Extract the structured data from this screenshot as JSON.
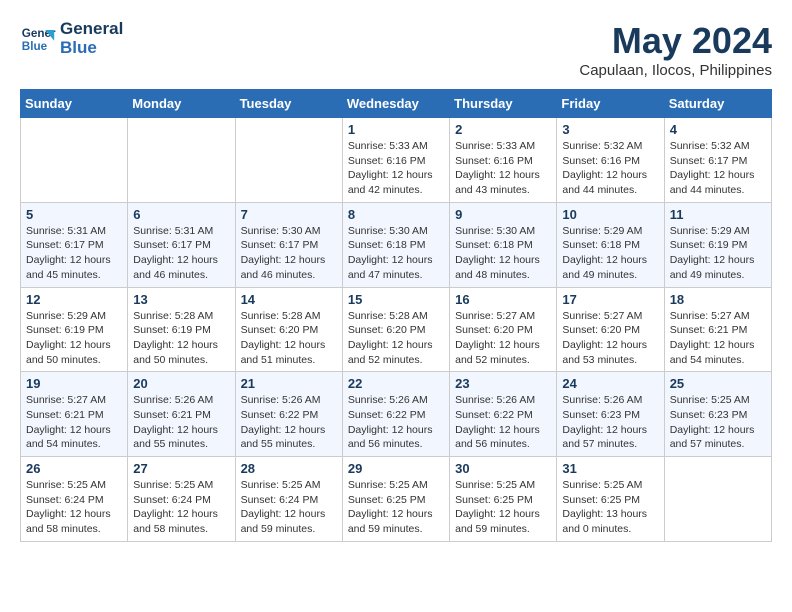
{
  "header": {
    "logo_line1": "General",
    "logo_line2": "Blue",
    "month_title": "May 2024",
    "location": "Capulaan, Ilocos, Philippines"
  },
  "weekdays": [
    "Sunday",
    "Monday",
    "Tuesday",
    "Wednesday",
    "Thursday",
    "Friday",
    "Saturday"
  ],
  "weeks": [
    [
      {
        "day": "",
        "info": ""
      },
      {
        "day": "",
        "info": ""
      },
      {
        "day": "",
        "info": ""
      },
      {
        "day": "1",
        "info": "Sunrise: 5:33 AM\nSunset: 6:16 PM\nDaylight: 12 hours\nand 42 minutes."
      },
      {
        "day": "2",
        "info": "Sunrise: 5:33 AM\nSunset: 6:16 PM\nDaylight: 12 hours\nand 43 minutes."
      },
      {
        "day": "3",
        "info": "Sunrise: 5:32 AM\nSunset: 6:16 PM\nDaylight: 12 hours\nand 44 minutes."
      },
      {
        "day": "4",
        "info": "Sunrise: 5:32 AM\nSunset: 6:17 PM\nDaylight: 12 hours\nand 44 minutes."
      }
    ],
    [
      {
        "day": "5",
        "info": "Sunrise: 5:31 AM\nSunset: 6:17 PM\nDaylight: 12 hours\nand 45 minutes."
      },
      {
        "day": "6",
        "info": "Sunrise: 5:31 AM\nSunset: 6:17 PM\nDaylight: 12 hours\nand 46 minutes."
      },
      {
        "day": "7",
        "info": "Sunrise: 5:30 AM\nSunset: 6:17 PM\nDaylight: 12 hours\nand 46 minutes."
      },
      {
        "day": "8",
        "info": "Sunrise: 5:30 AM\nSunset: 6:18 PM\nDaylight: 12 hours\nand 47 minutes."
      },
      {
        "day": "9",
        "info": "Sunrise: 5:30 AM\nSunset: 6:18 PM\nDaylight: 12 hours\nand 48 minutes."
      },
      {
        "day": "10",
        "info": "Sunrise: 5:29 AM\nSunset: 6:18 PM\nDaylight: 12 hours\nand 49 minutes."
      },
      {
        "day": "11",
        "info": "Sunrise: 5:29 AM\nSunset: 6:19 PM\nDaylight: 12 hours\nand 49 minutes."
      }
    ],
    [
      {
        "day": "12",
        "info": "Sunrise: 5:29 AM\nSunset: 6:19 PM\nDaylight: 12 hours\nand 50 minutes."
      },
      {
        "day": "13",
        "info": "Sunrise: 5:28 AM\nSunset: 6:19 PM\nDaylight: 12 hours\nand 50 minutes."
      },
      {
        "day": "14",
        "info": "Sunrise: 5:28 AM\nSunset: 6:20 PM\nDaylight: 12 hours\nand 51 minutes."
      },
      {
        "day": "15",
        "info": "Sunrise: 5:28 AM\nSunset: 6:20 PM\nDaylight: 12 hours\nand 52 minutes."
      },
      {
        "day": "16",
        "info": "Sunrise: 5:27 AM\nSunset: 6:20 PM\nDaylight: 12 hours\nand 52 minutes."
      },
      {
        "day": "17",
        "info": "Sunrise: 5:27 AM\nSunset: 6:20 PM\nDaylight: 12 hours\nand 53 minutes."
      },
      {
        "day": "18",
        "info": "Sunrise: 5:27 AM\nSunset: 6:21 PM\nDaylight: 12 hours\nand 54 minutes."
      }
    ],
    [
      {
        "day": "19",
        "info": "Sunrise: 5:27 AM\nSunset: 6:21 PM\nDaylight: 12 hours\nand 54 minutes."
      },
      {
        "day": "20",
        "info": "Sunrise: 5:26 AM\nSunset: 6:21 PM\nDaylight: 12 hours\nand 55 minutes."
      },
      {
        "day": "21",
        "info": "Sunrise: 5:26 AM\nSunset: 6:22 PM\nDaylight: 12 hours\nand 55 minutes."
      },
      {
        "day": "22",
        "info": "Sunrise: 5:26 AM\nSunset: 6:22 PM\nDaylight: 12 hours\nand 56 minutes."
      },
      {
        "day": "23",
        "info": "Sunrise: 5:26 AM\nSunset: 6:22 PM\nDaylight: 12 hours\nand 56 minutes."
      },
      {
        "day": "24",
        "info": "Sunrise: 5:26 AM\nSunset: 6:23 PM\nDaylight: 12 hours\nand 57 minutes."
      },
      {
        "day": "25",
        "info": "Sunrise: 5:25 AM\nSunset: 6:23 PM\nDaylight: 12 hours\nand 57 minutes."
      }
    ],
    [
      {
        "day": "26",
        "info": "Sunrise: 5:25 AM\nSunset: 6:24 PM\nDaylight: 12 hours\nand 58 minutes."
      },
      {
        "day": "27",
        "info": "Sunrise: 5:25 AM\nSunset: 6:24 PM\nDaylight: 12 hours\nand 58 minutes."
      },
      {
        "day": "28",
        "info": "Sunrise: 5:25 AM\nSunset: 6:24 PM\nDaylight: 12 hours\nand 59 minutes."
      },
      {
        "day": "29",
        "info": "Sunrise: 5:25 AM\nSunset: 6:25 PM\nDaylight: 12 hours\nand 59 minutes."
      },
      {
        "day": "30",
        "info": "Sunrise: 5:25 AM\nSunset: 6:25 PM\nDaylight: 12 hours\nand 59 minutes."
      },
      {
        "day": "31",
        "info": "Sunrise: 5:25 AM\nSunset: 6:25 PM\nDaylight: 13 hours\nand 0 minutes."
      },
      {
        "day": "",
        "info": ""
      }
    ]
  ]
}
